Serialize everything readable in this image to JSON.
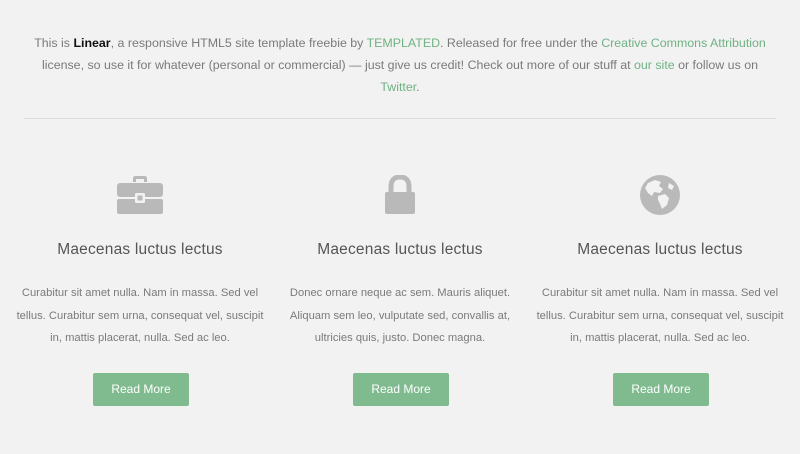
{
  "intro": {
    "prefix": "This is ",
    "name": "Linear",
    "text1": ", a responsive HTML5 site template freebie by ",
    "link_templated": "TEMPLATED",
    "text2": ". Released for free under the ",
    "link_license": "Creative Commons Attribution",
    "text3": " license, so use it for whatever (personal or commercial) — just give us credit! Check out more of our stuff at ",
    "link_site": "our site",
    "text4": " or follow us on ",
    "link_twitter": "Twitter",
    "text5": "."
  },
  "features": [
    {
      "icon": "briefcase-icon",
      "title": "Maecenas luctus lectus",
      "description": "Curabitur sit amet nulla. Nam in massa. Sed vel tellus. Curabitur sem urna, consequat vel, suscipit in, mattis placerat, nulla. Sed ac leo.",
      "button": "Read More"
    },
    {
      "icon": "lock-icon",
      "title": "Maecenas luctus lectus",
      "description": "Donec ornare neque ac sem. Mauris aliquet. Aliquam sem leo, vulputate sed, convallis at, ultricies quis, justo. Donec magna.",
      "button": "Read More"
    },
    {
      "icon": "globe-icon",
      "title": "Maecenas luctus lectus",
      "description": "Curabitur sit amet nulla. Nam in massa. Sed vel tellus. Curabitur sem urna, consequat vel, suscipit in, mattis placerat, nulla. Sed ac leo.",
      "button": "Read More"
    }
  ],
  "colors": {
    "background": "#f2f2f2",
    "accent": "#7fbb8e",
    "link": "#6fb283",
    "icon": "#b9b9b9",
    "text": "#7a7a7a"
  }
}
